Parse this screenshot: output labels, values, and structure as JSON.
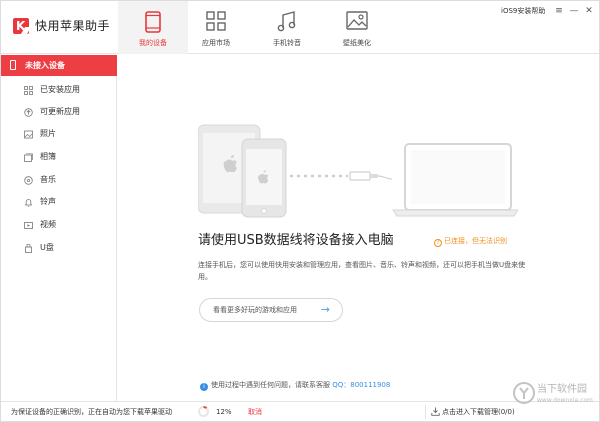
{
  "app": {
    "logo_letter": "K",
    "title": "快用苹果助手",
    "help_text": "iOS9安装帮助",
    "accent_color": "#ed3e44"
  },
  "nav": {
    "tabs": [
      {
        "label": "我的设备",
        "icon": "phone-icon",
        "active": true
      },
      {
        "label": "应用市场",
        "icon": "grid-icon",
        "active": false
      },
      {
        "label": "手机铃音",
        "icon": "music-icon",
        "active": false
      },
      {
        "label": "壁纸美化",
        "icon": "picture-icon",
        "active": false
      }
    ]
  },
  "window_controls": {
    "menu": "≡",
    "minimize": "—",
    "close": "✕"
  },
  "sidebar": {
    "header": "未接入设备",
    "items": [
      {
        "label": "已安装应用",
        "icon": "apps-icon"
      },
      {
        "label": "可更新应用",
        "icon": "update-icon"
      },
      {
        "label": "照片",
        "icon": "photo-icon"
      },
      {
        "label": "相簿",
        "icon": "album-icon"
      },
      {
        "label": "音乐",
        "icon": "music-disc-icon"
      },
      {
        "label": "铃声",
        "icon": "bell-icon"
      },
      {
        "label": "视频",
        "icon": "video-icon"
      },
      {
        "label": "U盘",
        "icon": "usb-drive-icon"
      }
    ]
  },
  "main": {
    "headline": "请使用USB数据线将设备接入电脑",
    "status": "已连接，但无法识别",
    "description": "连接手机后，您可以使用快用安装和管理应用，查看图片、音乐、铃声和视频，还可以把手机当做U盘来使用。",
    "explore_button": "看看更多好玩的游戏和应用",
    "faq_prefix": "使用过程中遇到任何问题，请联系客服",
    "faq_qq": "QQ：800111908",
    "status_color": "#f0901e",
    "link_color": "#3a8ee6"
  },
  "statusbar": {
    "message": "为保证设备的正确识别，正在自动为您下载苹果驱动",
    "progress": 0.12,
    "progress_label": "12%",
    "cancel": "取消",
    "downloads": "点击进入下载管理(0/0)"
  },
  "watermark": {
    "text": "当下软件园",
    "url": "www.downxia.com"
  }
}
